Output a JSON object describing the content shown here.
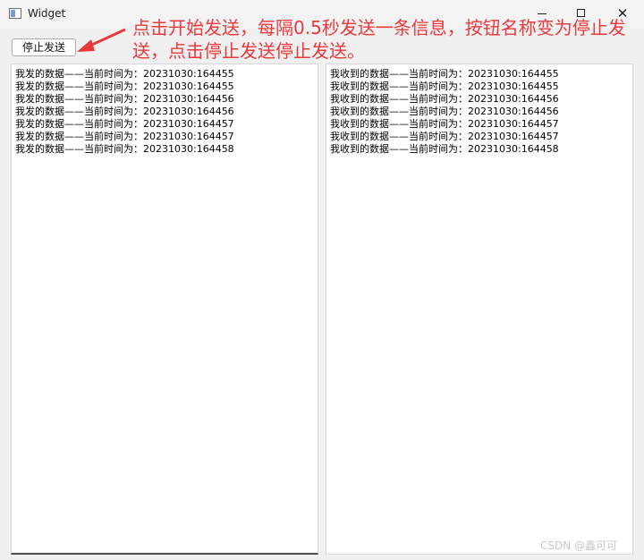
{
  "window": {
    "title": "Widget",
    "close_glyph": "✕"
  },
  "annotation": {
    "text": "点击开始发送，每隔0.5秒发送一条信息，按钮名称变为停止发送，点击停止发送停止发送。",
    "color": "#e8393c"
  },
  "toolbar": {
    "stop_send_label": "停止发送"
  },
  "sent_log": {
    "lines": [
      "我发的数据——当前时间为：20231030:164455",
      "我发的数据——当前时间为：20231030:164455",
      "我发的数据——当前时间为：20231030:164456",
      "我发的数据——当前时间为：20231030:164456",
      "我发的数据——当前时间为：20231030:164457",
      "我发的数据——当前时间为：20231030:164457",
      "我发的数据——当前时间为：20231030:164458"
    ]
  },
  "received_log": {
    "lines": [
      "我收到的数据——当前时间为：20231030:164455",
      "我收到的数据——当前时间为：20231030:164455",
      "我收到的数据——当前时间为：20231030:164456",
      "我收到的数据——当前时间为：20231030:164456",
      "我收到的数据——当前时间为：20231030:164457",
      "我收到的数据——当前时间为：20231030:164457",
      "我收到的数据——当前时间为：20231030:164458"
    ]
  },
  "watermark": {
    "text": "CSDN @鑫可可"
  }
}
